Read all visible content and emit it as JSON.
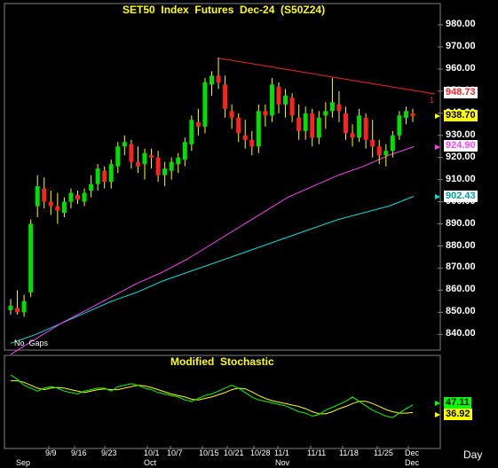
{
  "window": {
    "period_label": "Day"
  },
  "price_panel": {
    "title": "SET50  Index  Futures  Dec-24  (S50Z24)",
    "gap_note": "No  Gaps",
    "marker": "1",
    "yticks": [
      "980.00",
      "970.00",
      "960.00",
      "950.00",
      "940.00",
      "930.00",
      "920.00",
      "910.00",
      "900.00",
      "890.00",
      "880.00",
      "870.00",
      "860.00",
      "850.00",
      "840.00"
    ],
    "tags": {
      "trendline": "948.73",
      "last_price": "938.70",
      "ma_short": "924.90",
      "ma_long": "902.43"
    }
  },
  "stochastic_panel": {
    "title": "Modified  Stochastic",
    "tags": {
      "k": "47.11",
      "d": "36.92"
    }
  },
  "x_axis": {
    "dates": [
      "9/9",
      "9/16",
      "9/23",
      "10/1",
      "10/7",
      "10/15",
      "10/21",
      "10/28",
      "11/1",
      "11/11",
      "11/18",
      "11/25",
      "Dec"
    ],
    "months": [
      "Sep",
      "Oct",
      "Nov",
      "Dec"
    ]
  },
  "colors": {
    "up": "#00e000",
    "down": "#ff2020",
    "ma_short": "#ff40ff",
    "ma_long": "#00e0e0",
    "trendline": "#ff2020",
    "stoch_k": "#00ff00",
    "stoch_d": "#ffff00",
    "title": "#ffff00"
  },
  "chart_data": {
    "type": "candlestick",
    "title": "SET50  Index  Futures  Dec-24  (S50Z24)",
    "ylim": [
      835,
      987
    ],
    "last_price": 938.7,
    "indicators": {
      "ma_short_last": 924.9,
      "ma_long_last": 902.43,
      "trendline_last": 948.73,
      "stoch_k_last": 47.11,
      "stoch_d_last": 36.92
    },
    "candles": [
      {
        "o": 851,
        "h": 856,
        "l": 849,
        "c": 853
      },
      {
        "o": 852,
        "h": 860,
        "l": 849,
        "c": 850
      },
      {
        "o": 850,
        "h": 858,
        "l": 848,
        "c": 855
      },
      {
        "o": 859,
        "h": 892,
        "l": 857,
        "c": 890
      },
      {
        "o": 898,
        "h": 912,
        "l": 893,
        "c": 907
      },
      {
        "o": 906,
        "h": 911,
        "l": 897,
        "c": 900
      },
      {
        "o": 900,
        "h": 905,
        "l": 894,
        "c": 898
      },
      {
        "o": 898,
        "h": 904,
        "l": 890,
        "c": 896
      },
      {
        "o": 895,
        "h": 902,
        "l": 893,
        "c": 900
      },
      {
        "o": 900,
        "h": 906,
        "l": 897,
        "c": 904
      },
      {
        "o": 903,
        "h": 905,
        "l": 899,
        "c": 901
      },
      {
        "o": 900,
        "h": 906,
        "l": 898,
        "c": 904
      },
      {
        "o": 905,
        "h": 912,
        "l": 902,
        "c": 908
      },
      {
        "o": 908,
        "h": 917,
        "l": 905,
        "c": 915
      },
      {
        "o": 914,
        "h": 916,
        "l": 906,
        "c": 909
      },
      {
        "o": 909,
        "h": 919,
        "l": 906,
        "c": 917
      },
      {
        "o": 916,
        "h": 927,
        "l": 913,
        "c": 925
      },
      {
        "o": 925,
        "h": 930,
        "l": 921,
        "c": 927
      },
      {
        "o": 926,
        "h": 928,
        "l": 915,
        "c": 918
      },
      {
        "o": 918,
        "h": 925,
        "l": 913,
        "c": 916
      },
      {
        "o": 917,
        "h": 924,
        "l": 910,
        "c": 922
      },
      {
        "o": 921,
        "h": 924,
        "l": 915,
        "c": 920
      },
      {
        "o": 920,
        "h": 923,
        "l": 909,
        "c": 912
      },
      {
        "o": 912,
        "h": 918,
        "l": 907,
        "c": 915
      },
      {
        "o": 914,
        "h": 920,
        "l": 910,
        "c": 918
      },
      {
        "o": 917,
        "h": 922,
        "l": 913,
        "c": 920
      },
      {
        "o": 919,
        "h": 929,
        "l": 916,
        "c": 927
      },
      {
        "o": 926,
        "h": 939,
        "l": 923,
        "c": 937
      },
      {
        "o": 936,
        "h": 942,
        "l": 930,
        "c": 934
      },
      {
        "o": 934,
        "h": 956,
        "l": 931,
        "c": 954
      },
      {
        "o": 953,
        "h": 959,
        "l": 948,
        "c": 957
      },
      {
        "o": 957,
        "h": 965,
        "l": 951,
        "c": 954
      },
      {
        "o": 953,
        "h": 957,
        "l": 938,
        "c": 942
      },
      {
        "o": 941,
        "h": 944,
        "l": 933,
        "c": 938
      },
      {
        "o": 938,
        "h": 940,
        "l": 927,
        "c": 931
      },
      {
        "o": 930,
        "h": 937,
        "l": 924,
        "c": 928
      },
      {
        "o": 928,
        "h": 932,
        "l": 921,
        "c": 925
      },
      {
        "o": 925,
        "h": 944,
        "l": 922,
        "c": 941
      },
      {
        "o": 941,
        "h": 944,
        "l": 934,
        "c": 939
      },
      {
        "o": 939,
        "h": 956,
        "l": 936,
        "c": 953
      },
      {
        "o": 952,
        "h": 954,
        "l": 940,
        "c": 944
      },
      {
        "o": 944,
        "h": 951,
        "l": 938,
        "c": 948
      },
      {
        "o": 947,
        "h": 949,
        "l": 936,
        "c": 939
      },
      {
        "o": 938,
        "h": 944,
        "l": 928,
        "c": 932
      },
      {
        "o": 932,
        "h": 943,
        "l": 928,
        "c": 940
      },
      {
        "o": 940,
        "h": 942,
        "l": 925,
        "c": 929
      },
      {
        "o": 929,
        "h": 941,
        "l": 926,
        "c": 938
      },
      {
        "o": 939,
        "h": 945,
        "l": 933,
        "c": 941
      },
      {
        "o": 941,
        "h": 956,
        "l": 938,
        "c": 945
      },
      {
        "o": 944,
        "h": 950,
        "l": 936,
        "c": 941
      },
      {
        "o": 940,
        "h": 943,
        "l": 928,
        "c": 931
      },
      {
        "o": 931,
        "h": 935,
        "l": 925,
        "c": 929
      },
      {
        "o": 929,
        "h": 942,
        "l": 927,
        "c": 939
      },
      {
        "o": 938,
        "h": 940,
        "l": 924,
        "c": 928
      },
      {
        "o": 928,
        "h": 937,
        "l": 920,
        "c": 925
      },
      {
        "o": 925,
        "h": 928,
        "l": 917,
        "c": 921
      },
      {
        "o": 921,
        "h": 926,
        "l": 916,
        "c": 923
      },
      {
        "o": 923,
        "h": 932,
        "l": 920,
        "c": 930
      },
      {
        "o": 930,
        "h": 941,
        "l": 928,
        "c": 939
      },
      {
        "o": 938,
        "h": 943,
        "l": 935,
        "c": 941
      },
      {
        "o": 940,
        "h": 942,
        "l": 936,
        "c": 938.7
      }
    ],
    "ma_short": [
      [
        0,
        831
      ],
      [
        4,
        838
      ],
      [
        8,
        845
      ],
      [
        12,
        851
      ],
      [
        16,
        857
      ],
      [
        20,
        863
      ],
      [
        24,
        868
      ],
      [
        28,
        874
      ],
      [
        32,
        881
      ],
      [
        36,
        888
      ],
      [
        40,
        895
      ],
      [
        44,
        902
      ],
      [
        48,
        907
      ],
      [
        52,
        912
      ],
      [
        56,
        916
      ],
      [
        60,
        921
      ],
      [
        64,
        924.9
      ]
    ],
    "ma_long": [
      [
        0,
        836
      ],
      [
        4,
        840
      ],
      [
        8,
        845
      ],
      [
        12,
        850
      ],
      [
        16,
        855
      ],
      [
        20,
        859
      ],
      [
        24,
        864
      ],
      [
        28,
        868
      ],
      [
        32,
        872
      ],
      [
        36,
        876
      ],
      [
        40,
        880
      ],
      [
        44,
        884
      ],
      [
        48,
        888
      ],
      [
        52,
        892
      ],
      [
        56,
        895
      ],
      [
        60,
        898
      ],
      [
        64,
        902.43
      ]
    ],
    "trendline": [
      [
        30,
        965
      ],
      [
        64,
        948.73
      ]
    ],
    "stoch_k": [
      88,
      82,
      74,
      70,
      66,
      70,
      72,
      70,
      66,
      64,
      62,
      66,
      68,
      70,
      70,
      66,
      72,
      74,
      76,
      74,
      70,
      68,
      64,
      62,
      60,
      58,
      54,
      52,
      56,
      60,
      62,
      66,
      70,
      74,
      70,
      64,
      58,
      54,
      52,
      50,
      48,
      46,
      42,
      38,
      36,
      32,
      34,
      40,
      44,
      48,
      52,
      58,
      52,
      46,
      40,
      36,
      32,
      30,
      36,
      42,
      47.11
    ],
    "stoch_d": [
      80,
      80,
      78,
      74,
      70,
      68,
      70,
      71,
      70,
      68,
      66,
      64,
      66,
      68,
      69,
      68,
      68,
      70,
      72,
      74,
      73,
      71,
      68,
      65,
      62,
      60,
      58,
      55,
      54,
      56,
      58,
      61,
      64,
      68,
      70,
      69,
      65,
      60,
      56,
      53,
      51,
      49,
      47,
      45,
      42,
      38,
      35,
      35,
      38,
      42,
      45,
      49,
      52,
      52,
      49,
      45,
      41,
      38,
      36,
      36,
      36.92
    ]
  }
}
